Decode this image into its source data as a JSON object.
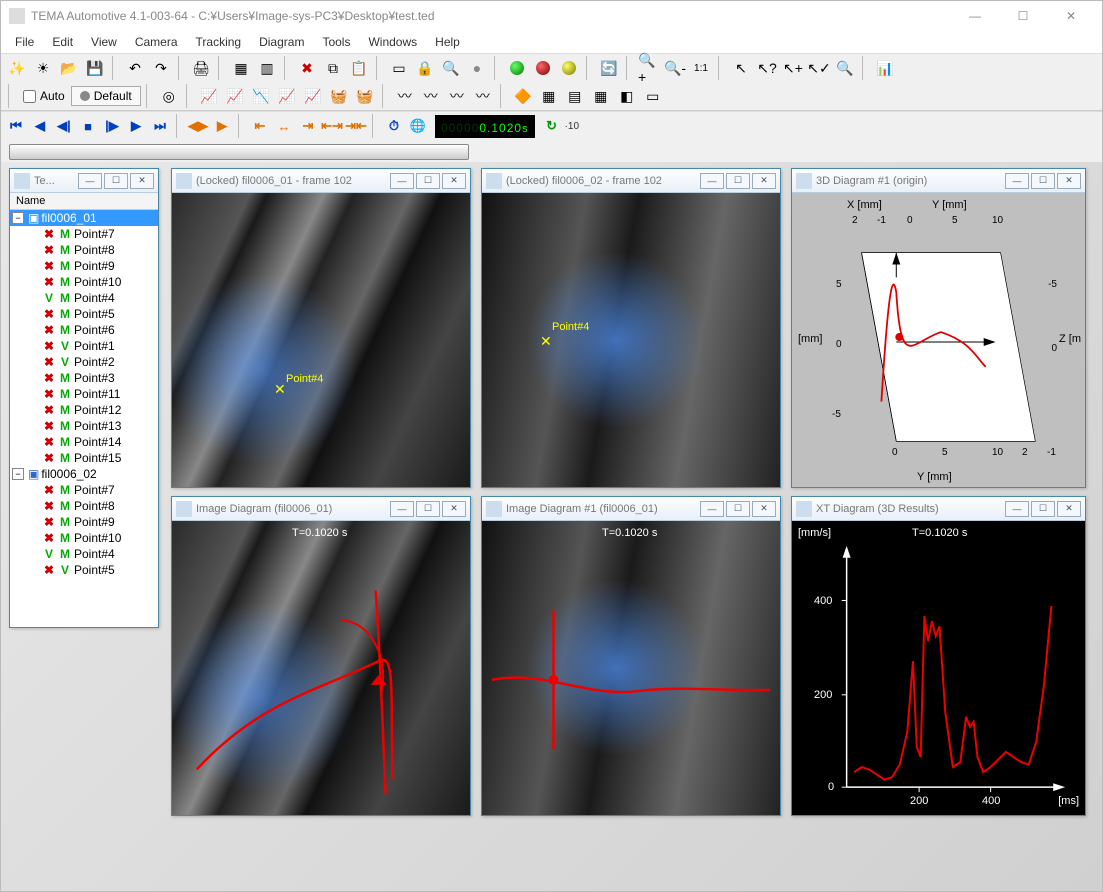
{
  "titlebar": {
    "title": "TEMA Automotive 4.1-003-64 - C:¥Users¥Image-sys-PC3¥Desktop¥test.ted"
  },
  "menu": [
    "File",
    "Edit",
    "View",
    "Camera",
    "Tracking",
    "Diagram",
    "Tools",
    "Windows",
    "Help"
  ],
  "toolbar2": {
    "auto": "Auto",
    "default": "Default"
  },
  "time_display": {
    "dim": "00000",
    "value": "0.1020",
    "unit": "s",
    "exp": "·10"
  },
  "tree": {
    "header": "Name",
    "root1": "fil0006_01",
    "root2": "fil0006_02",
    "items1": [
      {
        "x": "X",
        "m": "M",
        "label": "Point#7"
      },
      {
        "x": "X",
        "m": "M",
        "label": "Point#8"
      },
      {
        "x": "X",
        "m": "M",
        "label": "Point#9"
      },
      {
        "x": "X",
        "m": "M",
        "label": "Point#10"
      },
      {
        "x": "V",
        "m": "M",
        "label": "Point#4"
      },
      {
        "x": "X",
        "m": "M",
        "label": "Point#5"
      },
      {
        "x": "X",
        "m": "M",
        "label": "Point#6"
      },
      {
        "x": "X",
        "m": "V",
        "label": "Point#1"
      },
      {
        "x": "X",
        "m": "V",
        "label": "Point#2"
      },
      {
        "x": "X",
        "m": "M",
        "label": "Point#3"
      },
      {
        "x": "X",
        "m": "M",
        "label": "Point#11"
      },
      {
        "x": "X",
        "m": "M",
        "label": "Point#12"
      },
      {
        "x": "X",
        "m": "M",
        "label": "Point#13"
      },
      {
        "x": "X",
        "m": "M",
        "label": "Point#14"
      },
      {
        "x": "X",
        "m": "M",
        "label": "Point#15"
      }
    ],
    "items2": [
      {
        "x": "X",
        "m": "M",
        "label": "Point#7"
      },
      {
        "x": "X",
        "m": "M",
        "label": "Point#8"
      },
      {
        "x": "X",
        "m": "M",
        "label": "Point#9"
      },
      {
        "x": "X",
        "m": "M",
        "label": "Point#10"
      },
      {
        "x": "V",
        "m": "M",
        "label": "Point#4"
      },
      {
        "x": "X",
        "m": "V",
        "label": "Point#5"
      }
    ]
  },
  "panels": {
    "tree_title": "Te...",
    "cam1_title": "(Locked) fil0006_01 - frame 102",
    "cam2_title": "(Locked) fil0006_02 - frame 102",
    "diag3d_title": "3D Diagram #1 (origin)",
    "imgdiag1_title": "Image Diagram (fil0006_01)",
    "imgdiag2_title": "Image Diagram #1 (fil0006_01)",
    "xt_title": "XT Diagram (3D Results)",
    "point_label": "Point#4",
    "t_overlay": "T=0.1020 s"
  },
  "diag3d_labels": {
    "x_axis": "X   [mm]",
    "y_axis": "Y   [mm]",
    "z_axis": "Z   [m",
    "mm": "[mm]",
    "y_bottom": "Y   [mm]",
    "ticks_top": [
      "2",
      "-1",
      "0",
      "5",
      "10"
    ],
    "ticks_left": [
      "5",
      "0",
      "-5"
    ],
    "ticks_right": [
      "-5",
      "0"
    ],
    "ticks_bot_y": [
      "0",
      "5",
      "10"
    ],
    "ticks_bot_x": [
      "2",
      "-1"
    ]
  },
  "xt_labels": {
    "yunit": "[mm/s]",
    "xunit": "[ms]",
    "t": "T=0.1020 s",
    "yticks": [
      "400",
      "200",
      "0"
    ],
    "xticks": [
      "200",
      "400"
    ]
  },
  "chart_data": {
    "type": "line",
    "title": "XT Diagram (3D Results)",
    "xlabel": "[ms]",
    "ylabel": "[mm/s]",
    "xlim": [
      0,
      550
    ],
    "ylim": [
      0,
      450
    ],
    "x": [
      20,
      40,
      60,
      80,
      100,
      120,
      140,
      160,
      175,
      185,
      195,
      205,
      215,
      225,
      235,
      245,
      260,
      280,
      300,
      315,
      325,
      335,
      345,
      360,
      380,
      400,
      420,
      440,
      460,
      480,
      500,
      520,
      540
    ],
    "y": [
      30,
      40,
      35,
      25,
      15,
      20,
      45,
      110,
      250,
      80,
      60,
      340,
      290,
      330,
      300,
      320,
      150,
      40,
      50,
      140,
      120,
      130,
      60,
      30,
      40,
      55,
      70,
      60,
      50,
      45,
      90,
      200,
      360
    ],
    "annotation": "T=0.1020 s"
  }
}
